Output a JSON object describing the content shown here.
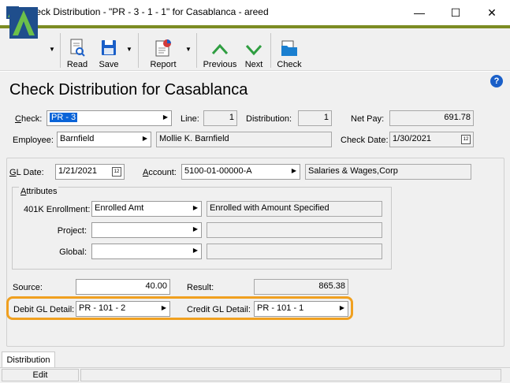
{
  "window": {
    "title": "Check Distribution - \"PR - 3 - 1 - 1\" for Casablanca - areed",
    "minimize": "—",
    "maximize": "☐",
    "close": "✕"
  },
  "toolbar": {
    "read": "Read",
    "save": "Save",
    "report": "Report",
    "previous": "Previous",
    "next": "Next",
    "check": "Check"
  },
  "page": {
    "heading": "Check Distribution for Casablanca",
    "help": "?"
  },
  "header_fields": {
    "check_label": "Check:",
    "check_value": "PR - 3",
    "line_label": "Line:",
    "line_value": "1",
    "distribution_label": "Distribution:",
    "distribution_value": "1",
    "net_pay_label": "Net Pay:",
    "net_pay_value": "691.78",
    "employee_label": "Employee:",
    "employee_value": "Barnfield",
    "employee_name": "Mollie K. Barnfield",
    "check_date_label": "Check Date:",
    "check_date_value": "1/30/2021"
  },
  "gl": {
    "gl_date_label": "GL Date:",
    "gl_date_value": "1/21/2021",
    "account_label": "Account:",
    "account_value": "5100-01-00000-A",
    "account_desc": "Salaries & Wages,Corp"
  },
  "attributes": {
    "group_label": "Attributes",
    "rows": [
      {
        "label": "401K Enrollment:",
        "value": "Enrolled Amt",
        "desc": "Enrolled with Amount Specified"
      },
      {
        "label": "Project:",
        "value": "",
        "desc": ""
      },
      {
        "label": "Global:",
        "value": "",
        "desc": ""
      }
    ]
  },
  "amounts": {
    "source_label": "Source:",
    "source_value": "40.00",
    "result_label": "Result:",
    "result_value": "865.38",
    "debit_label": "Debit GL Detail:",
    "debit_value": "PR - 101 - 2",
    "credit_label": "Credit GL Detail:",
    "credit_value": "PR - 101 - 1"
  },
  "tabs": {
    "distribution": "Distribution"
  },
  "status": {
    "edit": "Edit"
  },
  "colors": {
    "accent": "#7c8c23",
    "highlight": "#f0a020",
    "selection": "#0a64d8"
  }
}
